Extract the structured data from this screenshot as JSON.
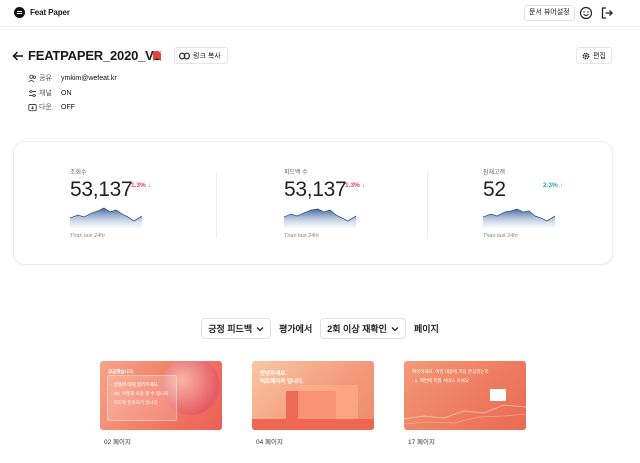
{
  "app": {
    "name": "Feat Paper"
  },
  "topbar": {
    "viewer_settings_label": "문서 뷰어설정"
  },
  "document": {
    "title": "FEATPAPER_2020_V2",
    "copy_link_label": "링크 복사",
    "edit_label": "편집",
    "meta": {
      "share": {
        "label": "공유",
        "value": "ymkim@wefeat.kr"
      },
      "channel": {
        "label": "채널",
        "value": "ON"
      },
      "download": {
        "label": "다운",
        "value": "OFF"
      }
    }
  },
  "stats": [
    {
      "label": "조회수",
      "value": "53,137",
      "delta": "1.3% ↓",
      "direction": "down",
      "caption": "Than last 24hr"
    },
    {
      "label": "피드백 수",
      "value": "53,137",
      "delta": "1.3% ↓",
      "direction": "down",
      "caption": "Than last 24hr"
    },
    {
      "label": "잠재고객",
      "value": "52",
      "delta": "2.3% ↑",
      "direction": "up",
      "caption": "Than last 24hr"
    }
  ],
  "filter": {
    "feedback_type": "긍정 피드백",
    "mid_text": "평가에서",
    "recheck": "2회 이상 재확인",
    "end_text": "페이지"
  },
  "pages": [
    {
      "label": "02 페이지",
      "lines": [
        "긍금했습니다.",
        "· 상품에 대해 알려주세요",
        "· 2D, 어떻게 사용 할 수 있나요",
        "· 피드백 문의하기 합니다"
      ]
    },
    {
      "label": "04 페이지",
      "lines": [
        "안녕하세요.",
        "피트페이퍼 입니다."
      ]
    },
    {
      "label": "17 페이지",
      "lines": [
        "확인하세요. 이번 내용에 가장 관심있는지",
        "· 1. 매번에 특별 서비스 하세요"
      ]
    }
  ],
  "colors": {
    "delta_down": "#e0405a",
    "delta_up": "#2ba88a",
    "spark_top": "#4a6fa5",
    "thumb_orange": "#f07a5a"
  }
}
